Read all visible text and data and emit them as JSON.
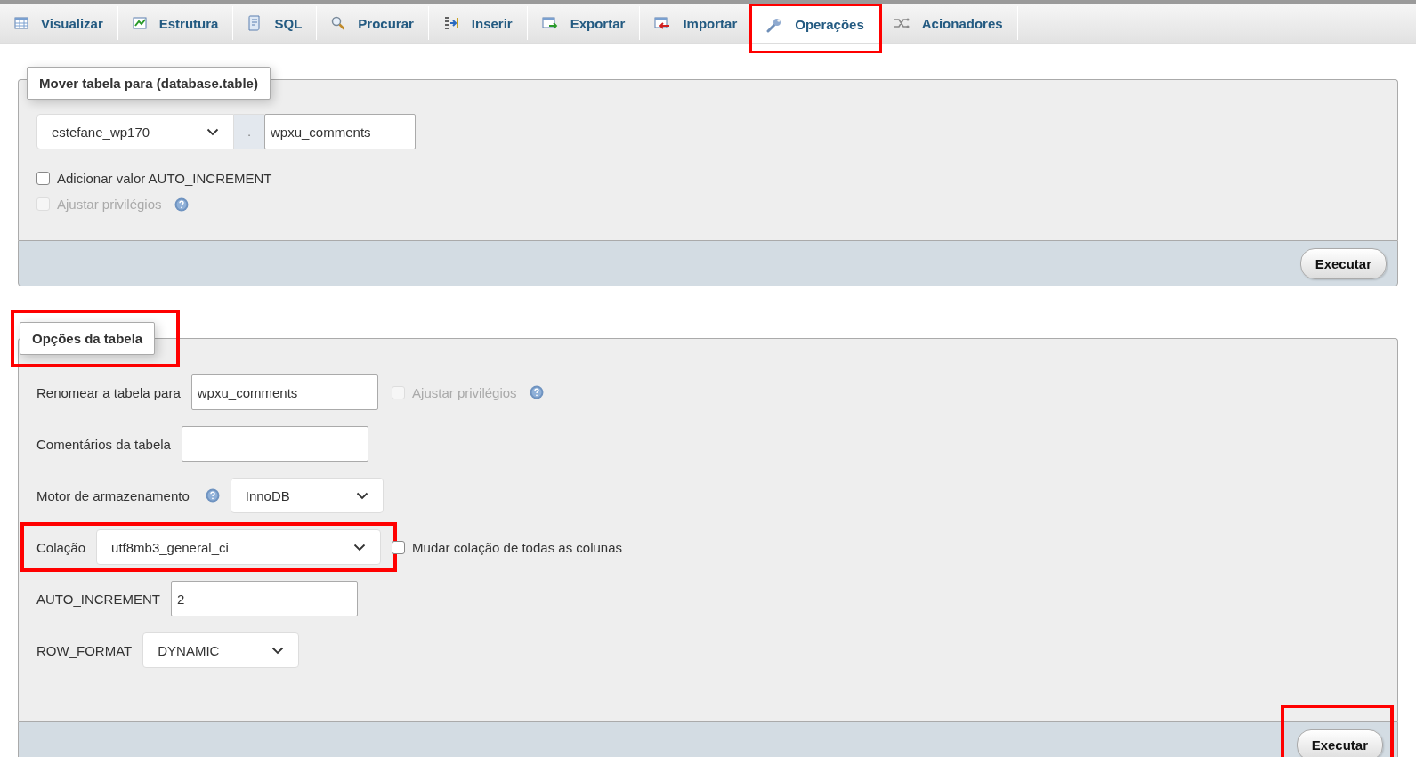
{
  "tabs": [
    {
      "label": "Visualizar",
      "selected": false,
      "highlighted": false
    },
    {
      "label": "Estrutura",
      "selected": false,
      "highlighted": false
    },
    {
      "label": "SQL",
      "selected": false,
      "highlighted": false
    },
    {
      "label": "Procurar",
      "selected": false,
      "highlighted": false
    },
    {
      "label": "Inserir",
      "selected": false,
      "highlighted": false
    },
    {
      "label": "Exportar",
      "selected": false,
      "highlighted": false
    },
    {
      "label": "Importar",
      "selected": false,
      "highlighted": false
    },
    {
      "label": "Operações",
      "selected": true,
      "highlighted": true
    },
    {
      "label": "Acionadores",
      "selected": false,
      "highlighted": false
    }
  ],
  "move_table": {
    "legend": "Mover tabela para (database.table)",
    "highlighted": false,
    "database": "estefane_wp170",
    "separator": ".",
    "table_name": "wpxu_comments",
    "options": [
      {
        "label": "Adicionar valor AUTO_INCREMENT",
        "checked": false,
        "disabled": false,
        "help": false
      },
      {
        "label": "Ajustar privilégios",
        "checked": false,
        "disabled": true,
        "help": true
      }
    ],
    "button": {
      "label": "Executar",
      "highlighted": false
    }
  },
  "table_options": {
    "legend": "Opções da tabela",
    "highlighted": true,
    "rows": [
      {
        "kind": "input",
        "label": "Renomear a tabela para",
        "value": "wpxu_comments",
        "help": false,
        "highlighted": false,
        "extra": {
          "label": "Ajustar privilégios",
          "checked": false,
          "disabled": true,
          "help": true
        }
      },
      {
        "kind": "input",
        "label": "Comentários da tabela",
        "value": "",
        "help": false,
        "highlighted": false
      },
      {
        "kind": "select",
        "label": "Motor de armazenamento",
        "value": "InnoDB",
        "help": true,
        "highlighted": false
      },
      {
        "kind": "select",
        "label": "Colação",
        "value": "utf8mb3_general_ci",
        "help": false,
        "highlighted": true,
        "extra": {
          "label": "Mudar colação de todas as colunas",
          "checked": false,
          "disabled": false,
          "help": false
        }
      },
      {
        "kind": "input",
        "label": "AUTO_INCREMENT",
        "value": "2",
        "help": false,
        "highlighted": false
      },
      {
        "kind": "select",
        "label": "ROW_FORMAT",
        "value": "DYNAMIC",
        "help": false,
        "highlighted": false
      }
    ],
    "button": {
      "label": "Executar",
      "highlighted": true
    }
  }
}
